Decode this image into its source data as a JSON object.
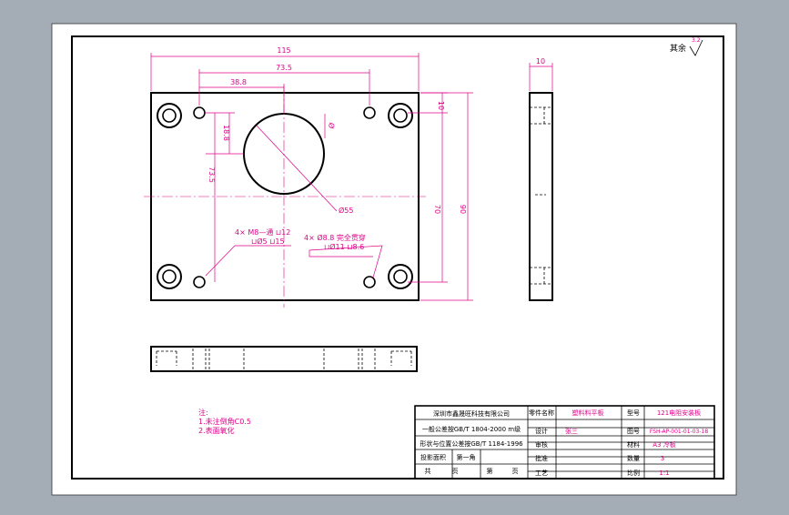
{
  "colors": {
    "background": "#a4adb6",
    "sheet": "#ffffff",
    "ink": "#000000",
    "dimension": "#e0008a"
  },
  "dimensions": {
    "width_115": "115",
    "width_73_5": "73.5",
    "width_38_8": "38.8",
    "height_10": "10",
    "height_70": "70",
    "height_90": "90",
    "left_73_5": "73.5",
    "left_18_8": "18.8",
    "dia_label": "Ø",
    "hole_55": "Ø55",
    "side_10": "10"
  },
  "hole_notes": {
    "note_a_line1": "4×  M8—通  ⊔12",
    "note_a_line2": "⊔Ø5  ⊔15",
    "note_b_line1": "4×  Ø8.8  完全贯穿",
    "note_b_line2": "⊔Ø11  ⊔8.6"
  },
  "roughness": {
    "label": "其余",
    "value": "3.2"
  },
  "notes": {
    "title": "注:",
    "line1": "1.未注倒角C0.5",
    "line2": "2.表面氧化"
  },
  "title_block": {
    "company": "深圳市鑫晟旺科技有限公司",
    "std1": "一般公差按GB/T 1804-2000  m级",
    "std2": "形状与位置公差按GB/T 1184-1996",
    "proj_label": "投影面积",
    "proj_val1": "第一角",
    "total": "共",
    "page": "页",
    "seq": "第",
    "page2": "页",
    "part_name_label": "零件名称",
    "part_name_value": "塑料料平板",
    "drawing_no_label": "图号",
    "drawing_no_value": "FSH-AP-001-01-03-18",
    "design": "设计",
    "design_value": "张三",
    "check": "审核",
    "approve": "批准",
    "process": "工艺",
    "material": "材料",
    "material_value": "A3 冷板",
    "quantity": "数量",
    "quantity_value": "3",
    "scale": "比例",
    "scale_value": "1:1",
    "model_label": "型号",
    "model_value": "121电阻安装板"
  }
}
